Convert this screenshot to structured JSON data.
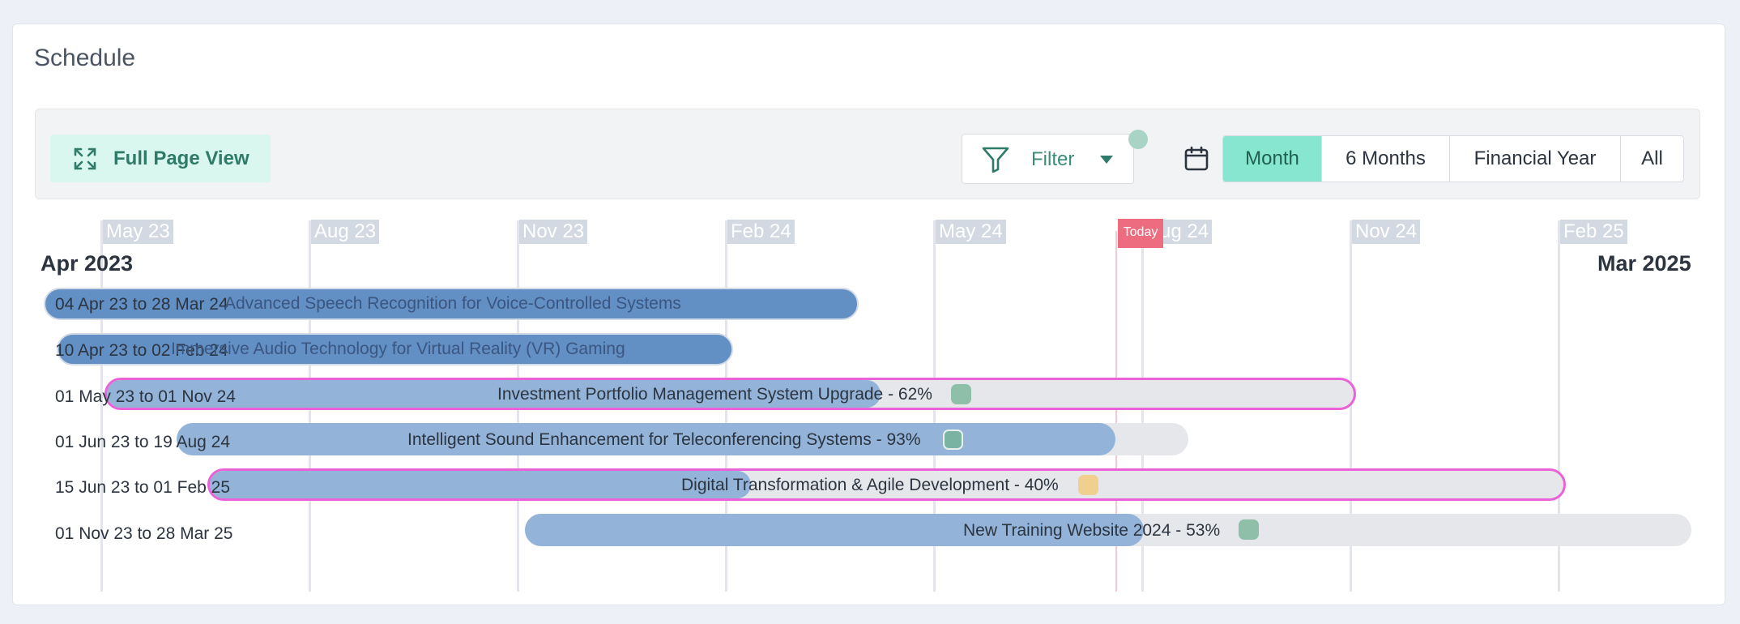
{
  "page": {
    "title": "Schedule"
  },
  "toolbar": {
    "full_page_label": "Full Page View",
    "filter_label": "Filter",
    "views": [
      {
        "label": "Month",
        "active": true
      },
      {
        "label": "6 Months",
        "active": false
      },
      {
        "label": "Financial Year",
        "active": false
      },
      {
        "label": "All",
        "active": false
      }
    ]
  },
  "timeline": {
    "start_label": "Apr 2023",
    "end_label": "Mar 2025",
    "today_label": "Today",
    "months": [
      "May 23",
      "Aug 23",
      "Nov 23",
      "Feb 24",
      "May 24",
      "Aug 24",
      "Nov 24",
      "Feb 25"
    ]
  },
  "rows": [
    {
      "dates": "04 Apr 23 to 28 Mar 24",
      "name": "Advanced Speech Recognition for Voice-Controlled Systems",
      "progress": 100,
      "critical": false,
      "status_color": ""
    },
    {
      "dates": "10 Apr 23 to 02 Feb 24",
      "name": "Immersive Audio Technology for Virtual Reality (VR) Gaming",
      "progress": 100,
      "critical": false,
      "status_color": ""
    },
    {
      "dates": "01 May 23 to 01 Nov 24",
      "name": "Investment Portfolio Management System Upgrade - 62%",
      "progress": 62,
      "critical": true,
      "status_color": "#8fbfa8"
    },
    {
      "dates": "01 Jun 23 to 19 Aug 24",
      "name": "Intelligent Sound Enhancement for Teleconferencing Systems - 93%",
      "progress": 93,
      "critical": false,
      "status_color": "#7bb3a2"
    },
    {
      "dates": "15 Jun 23 to 01 Feb 25",
      "name": "Digital Transformation & Agile Development - 40%",
      "progress": 40,
      "critical": true,
      "status_color": "#f0d08e"
    },
    {
      "dates": "01 Nov 23 to 28 Mar 25",
      "name": "New Training Website 2024 - 53%",
      "progress": 53,
      "critical": false,
      "status_color": "#8fbfa8"
    }
  ],
  "colors": {
    "accent": "#86e6cf",
    "critical_border": "#ea61d8",
    "today": "#ee6c80"
  }
}
